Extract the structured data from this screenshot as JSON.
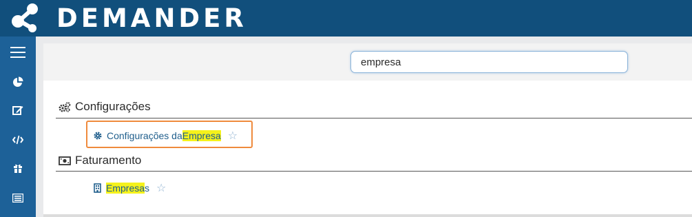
{
  "app": {
    "brand": "DEMANDER",
    "colors": {
      "header": "#114f7c",
      "sidebar": "#1d6198",
      "highlight": "#f5f21b",
      "focus": "#ef8a3c",
      "link": "#1f5e8c"
    }
  },
  "sidebar": {
    "items": [
      {
        "name": "menu",
        "icon": "hamburger-icon"
      },
      {
        "name": "dashboard",
        "icon": "pie-chart-icon"
      },
      {
        "name": "edit",
        "icon": "edit-icon"
      },
      {
        "name": "code",
        "icon": "code-icon"
      },
      {
        "name": "gift",
        "icon": "gift-icon"
      },
      {
        "name": "list",
        "icon": "list-icon"
      }
    ]
  },
  "search": {
    "value": "empresa"
  },
  "results": {
    "groups": [
      {
        "title": "Configurações",
        "icon": "gears-icon",
        "items": [
          {
            "text_before": "Configurações da ",
            "highlight": "Empresa",
            "text_after": "",
            "icon": "gear-icon",
            "selected": true
          }
        ]
      },
      {
        "title": "Faturamento",
        "icon": "money-icon",
        "items": [
          {
            "text_before": "",
            "highlight": "Empresa",
            "text_after": "s",
            "icon": "building-icon",
            "selected": false
          }
        ]
      }
    ],
    "star_glyph": "☆"
  }
}
